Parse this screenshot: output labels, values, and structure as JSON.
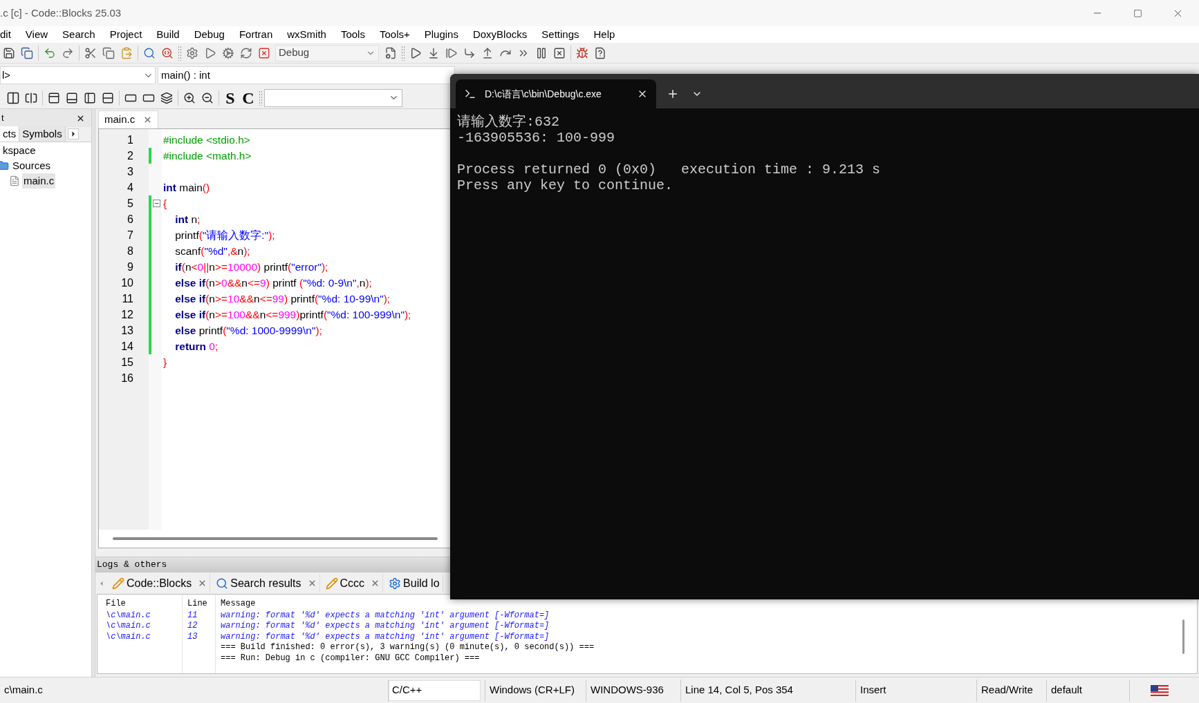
{
  "window": {
    "title": ".c [c] - Code::Blocks 25.03"
  },
  "menu": [
    "dit",
    "View",
    "Search",
    "Project",
    "Build",
    "Debug",
    "Fortran",
    "wxSmith",
    "Tools",
    "Tools+",
    "Plugins",
    "DoxyBlocks",
    "Settings",
    "Help"
  ],
  "toolbar": {
    "build_target": "Debug"
  },
  "code_bar": {
    "scope": "l>",
    "function": "main() : int"
  },
  "toolbar_2": {
    "letters": [
      "S",
      "C"
    ]
  },
  "management": {
    "title": "t",
    "tabs": [
      {
        "label": "cts",
        "selected": true
      },
      {
        "label": "Symbols",
        "selected": false
      }
    ],
    "tree": [
      {
        "label": "kspace",
        "selected": false,
        "children": [
          {
            "label": "Sources",
            "kind": "folder",
            "selected": false,
            "children": [
              {
                "label": "main.c",
                "kind": "file",
                "selected": true
              }
            ]
          }
        ]
      }
    ]
  },
  "editor": {
    "tabs": [
      {
        "label": "main.c",
        "selected": true
      }
    ],
    "lines": [
      {
        "number": "1",
        "changed": false,
        "tokens": [
          {
            "kind": "pp",
            "text": "#include <stdio.h>"
          }
        ]
      },
      {
        "number": "2",
        "changed": true,
        "tokens": [
          {
            "kind": "pp",
            "text": "#include <math.h>"
          }
        ]
      },
      {
        "number": "3",
        "changed": false
      },
      {
        "number": "4",
        "changed": false,
        "tokens": [
          {
            "kind": "kw",
            "text": "int"
          },
          {
            "kind": "plain",
            "text": " main"
          },
          {
            "kind": "op",
            "text": "()"
          }
        ]
      },
      {
        "number": "5",
        "changed": true,
        "fold": true,
        "tokens": [
          {
            "kind": "op",
            "text": "{"
          }
        ]
      },
      {
        "number": "6",
        "changed": true,
        "tokens": [
          {
            "kind": "kw",
            "text": "    int"
          },
          {
            "kind": "plain",
            "text": " n"
          },
          {
            "kind": "op",
            "text": ";"
          }
        ]
      },
      {
        "number": "7",
        "changed": true,
        "tokens": [
          {
            "kind": "plain",
            "text": "    printf"
          },
          {
            "kind": "op",
            "text": "("
          },
          {
            "kind": "str",
            "text": "\"请输入数字:\""
          },
          {
            "kind": "op",
            "text": ");"
          }
        ]
      },
      {
        "number": "8",
        "changed": true,
        "tokens": [
          {
            "kind": "plain",
            "text": "    scanf"
          },
          {
            "kind": "op",
            "text": "("
          },
          {
            "kind": "str",
            "text": "\"%d\""
          },
          {
            "kind": "op",
            "text": ",&"
          },
          {
            "kind": "plain",
            "text": "n"
          },
          {
            "kind": "op",
            "text": ");"
          }
        ]
      },
      {
        "number": "9",
        "changed": true,
        "tokens": [
          {
            "kind": "kw",
            "text": "    if"
          },
          {
            "kind": "op",
            "text": "("
          },
          {
            "kind": "plain",
            "text": "n"
          },
          {
            "kind": "op",
            "text": "<"
          },
          {
            "kind": "num",
            "text": "0"
          },
          {
            "kind": "op",
            "text": "||"
          },
          {
            "kind": "plain",
            "text": "n"
          },
          {
            "kind": "op",
            "text": ">="
          },
          {
            "kind": "num",
            "text": "10000"
          },
          {
            "kind": "op",
            "text": ")"
          },
          {
            "kind": "plain",
            "text": " printf"
          },
          {
            "kind": "op",
            "text": "("
          },
          {
            "kind": "str",
            "text": "\"error\""
          },
          {
            "kind": "op",
            "text": ");"
          }
        ]
      },
      {
        "number": "10",
        "changed": true,
        "tokens": [
          {
            "kind": "kw",
            "text": "    else if"
          },
          {
            "kind": "op",
            "text": "("
          },
          {
            "kind": "plain",
            "text": "n"
          },
          {
            "kind": "op",
            "text": ">"
          },
          {
            "kind": "num",
            "text": "0"
          },
          {
            "kind": "op",
            "text": "&&"
          },
          {
            "kind": "plain",
            "text": "n"
          },
          {
            "kind": "op",
            "text": "<="
          },
          {
            "kind": "num",
            "text": "9"
          },
          {
            "kind": "op",
            "text": ")"
          },
          {
            "kind": "plain",
            "text": " printf "
          },
          {
            "kind": "op",
            "text": "("
          },
          {
            "kind": "str",
            "text": "\"%d: 0-9\\n\""
          },
          {
            "kind": "op",
            "text": ","
          },
          {
            "kind": "plain",
            "text": "n"
          },
          {
            "kind": "op",
            "text": ");"
          }
        ]
      },
      {
        "number": "11",
        "changed": true,
        "tokens": [
          {
            "kind": "kw",
            "text": "    else if"
          },
          {
            "kind": "op",
            "text": "("
          },
          {
            "kind": "plain",
            "text": "n"
          },
          {
            "kind": "op",
            "text": ">="
          },
          {
            "kind": "num",
            "text": "10"
          },
          {
            "kind": "op",
            "text": "&&"
          },
          {
            "kind": "plain",
            "text": "n"
          },
          {
            "kind": "op",
            "text": "<="
          },
          {
            "kind": "num",
            "text": "99"
          },
          {
            "kind": "op",
            "text": ")"
          },
          {
            "kind": "plain",
            "text": " printf"
          },
          {
            "kind": "op",
            "text": "("
          },
          {
            "kind": "str",
            "text": "\"%d: 10-99\\n\""
          },
          {
            "kind": "op",
            "text": ");"
          }
        ]
      },
      {
        "number": "12",
        "changed": true,
        "tokens": [
          {
            "kind": "kw",
            "text": "    else if"
          },
          {
            "kind": "op",
            "text": "("
          },
          {
            "kind": "plain",
            "text": "n"
          },
          {
            "kind": "op",
            "text": ">="
          },
          {
            "kind": "num",
            "text": "100"
          },
          {
            "kind": "op",
            "text": "&&"
          },
          {
            "kind": "plain",
            "text": "n"
          },
          {
            "kind": "op",
            "text": "<="
          },
          {
            "kind": "num",
            "text": "999"
          },
          {
            "kind": "op",
            "text": ")"
          },
          {
            "kind": "plain",
            "text": "printf"
          },
          {
            "kind": "op",
            "text": "("
          },
          {
            "kind": "str",
            "text": "\"%d: 100-999\\n\""
          },
          {
            "kind": "op",
            "text": ");"
          }
        ]
      },
      {
        "number": "13",
        "changed": true,
        "tokens": [
          {
            "kind": "kw",
            "text": "    else"
          },
          {
            "kind": "plain",
            "text": " printf"
          },
          {
            "kind": "op",
            "text": "("
          },
          {
            "kind": "str",
            "text": "\"%d: 1000-9999\\n\""
          },
          {
            "kind": "op",
            "text": ");"
          }
        ]
      },
      {
        "number": "14",
        "changed": true,
        "tokens": [
          {
            "kind": "kw",
            "text": "    return"
          },
          {
            "kind": "num",
            "text": " 0"
          },
          {
            "kind": "op",
            "text": ";"
          }
        ]
      },
      {
        "number": "15",
        "changed": false,
        "tokens": [
          {
            "kind": "op",
            "text": "}"
          }
        ]
      },
      {
        "number": "16",
        "changed": false
      }
    ]
  },
  "logs": {
    "title": "Logs & others",
    "tabs": [
      {
        "label": "Code::Blocks",
        "kind": "note",
        "selected": false
      },
      {
        "label": "Search results",
        "kind": "search",
        "selected": false
      },
      {
        "label": "Cccc",
        "kind": "note",
        "selected": false
      },
      {
        "label": "Build lo",
        "kind": "gear",
        "selected": false
      }
    ],
    "columns": [
      "File",
      "Line",
      "Message"
    ],
    "rows": [
      {
        "kind": "warning",
        "file": "\\c\\main.c",
        "line": "11",
        "message": "warning: format '%d' expects a matching 'int' argument [-Wformat=]"
      },
      {
        "kind": "warning",
        "file": "\\c\\main.c",
        "line": "12",
        "message": "warning: format '%d' expects a matching 'int' argument [-Wformat=]"
      },
      {
        "kind": "warning",
        "file": "\\c\\main.c",
        "line": "13",
        "message": "warning: format '%d' expects a matching 'int' argument [-Wformat=]"
      },
      {
        "kind": "info",
        "message": "=== Build finished: 0 error(s), 3 warning(s) (0 minute(s), 0 second(s)) ==="
      },
      {
        "kind": "info",
        "message": "=== Run: Debug in c (compiler: GNU GCC Compiler) ==="
      }
    ]
  },
  "status_bar": [
    {
      "kind": "text",
      "text": "c\\main.c"
    },
    {
      "kind": "field",
      "text": "C/C++"
    },
    {
      "kind": "text",
      "text": "Windows (CR+LF)"
    },
    {
      "kind": "text",
      "text": "WINDOWS-936"
    },
    {
      "kind": "text",
      "text": "Line 14, Col 5, Pos 354"
    },
    {
      "kind": "text",
      "text": "Insert"
    },
    {
      "kind": "text",
      "text": "Read/Write"
    },
    {
      "kind": "text",
      "text": "default"
    }
  ],
  "console": {
    "tabs": [
      {
        "title": "D:\\c语言\\c\\bin\\Debug\\c.exe",
        "selected": true
      }
    ],
    "blocks": [
      [
        "请输入数字:632",
        "-163905536: 100-999"
      ],
      [
        "Process returned 0 (0x0)   execution time : 9.213 s",
        "Press any key to continue."
      ]
    ]
  }
}
